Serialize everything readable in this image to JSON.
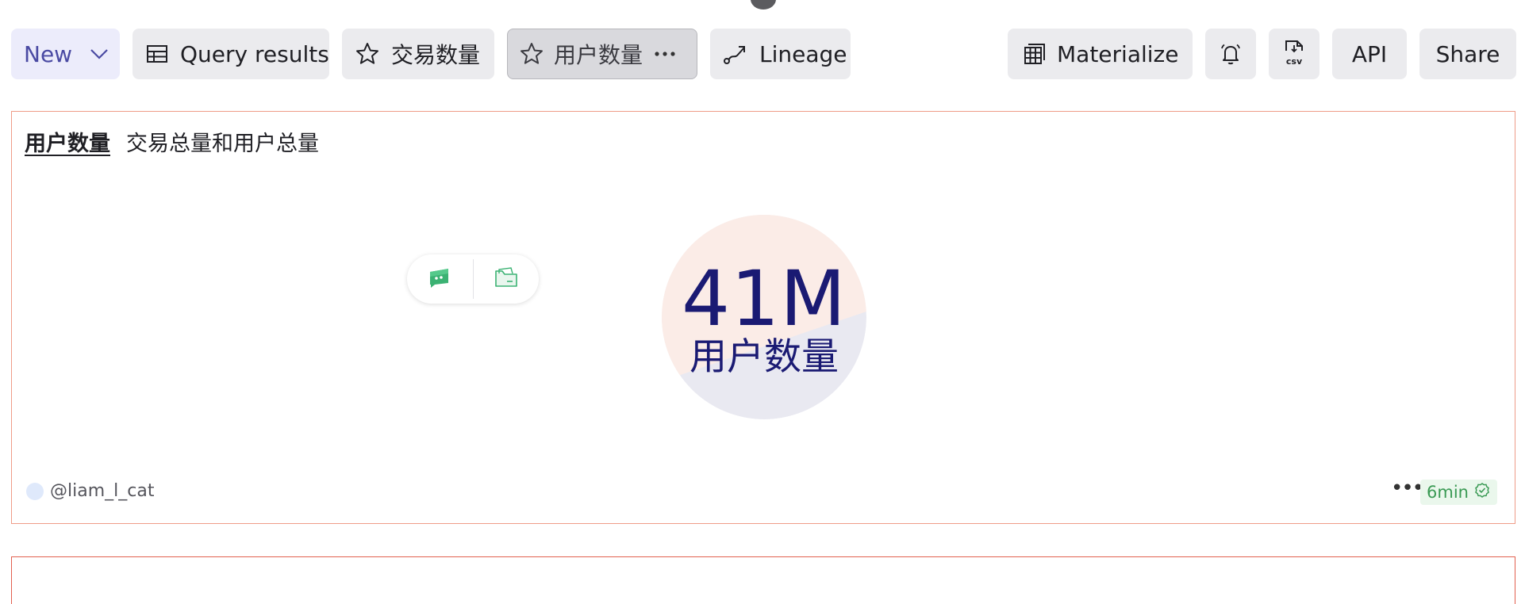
{
  "toolbar": {
    "new_label": "New",
    "query_results_label": "Query results",
    "favorite_tx_label": "交易数量",
    "favorite_users_label": "用户数量",
    "lineage_label": "Lineage",
    "materialize_label": "Materialize",
    "csv_icon_text": "csv",
    "api_label": "API",
    "share_label": "Share"
  },
  "panel": {
    "title": "用户数量",
    "subtitle": "交易总量和用户总量",
    "kpi": {
      "value": "41M",
      "label": "用户数量"
    },
    "author": "@liam_l_cat",
    "more": "•••",
    "age": "6min"
  },
  "colors": {
    "accent": "#1a1a73",
    "panel_border": "#ef9c88",
    "status_green": "#3a9a54"
  }
}
